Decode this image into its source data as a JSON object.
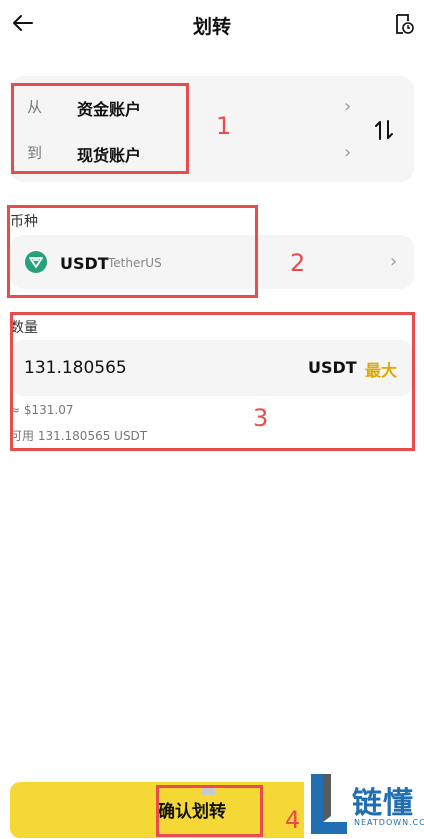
{
  "header": {
    "title": "划转",
    "back_icon": "back-arrow-icon",
    "history_icon": "history-icon"
  },
  "transfer": {
    "from_label": "从",
    "from_value": "资金账户",
    "to_label": "到",
    "to_value": "现货账户"
  },
  "coin": {
    "section_label": "币种",
    "symbol": "USDT",
    "name": "TetherUS"
  },
  "amount": {
    "section_label": "数量",
    "value": "131.180565",
    "unit": "USDT",
    "max_label": "最大",
    "fiat_value": "≈ $131.07",
    "available": "可用 131.180565 USDT"
  },
  "confirm": {
    "label": "确认划转"
  },
  "annotations": [
    "1",
    "2",
    "3",
    "4"
  ],
  "watermark": {
    "text": "链懂",
    "sub": "NEATDOWN.COM"
  },
  "colors": {
    "accent_yellow": "#f5d835",
    "max_text": "#e0a800",
    "annotation_red": "#e84c4c",
    "brand_blue": "#1f6fb2",
    "usdt_green": "#26a17b"
  }
}
